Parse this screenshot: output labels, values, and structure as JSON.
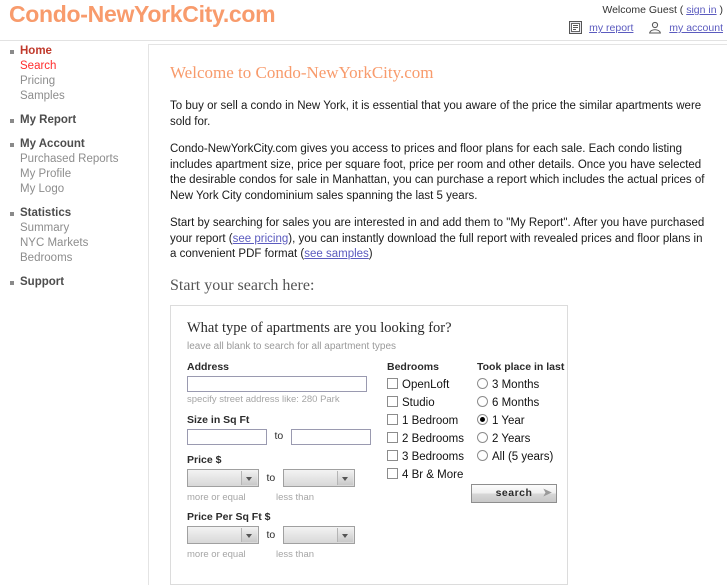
{
  "header": {
    "logo": "Condo-NewYorkCity.com",
    "welcome_prefix": "Welcome Guest (",
    "sign_in": "sign in",
    "welcome_suffix": ")",
    "my_report": "my report",
    "my_account": "my account",
    "report_icon": "report-icon",
    "account_icon": "account-person-icon",
    "logo_color": "#f89b6c",
    "link_color": "#5b5bbf"
  },
  "sidebar": {
    "groups": [
      {
        "head": "Home",
        "head_state": "home",
        "items": [
          {
            "label": "Search",
            "active": true
          },
          {
            "label": "Pricing",
            "active": false
          },
          {
            "label": "Samples",
            "active": false
          }
        ]
      },
      {
        "head": "My Report",
        "head_state": "normal",
        "items": []
      },
      {
        "head": "My Account",
        "head_state": "normal",
        "items": [
          {
            "label": "Purchased Reports",
            "active": false
          },
          {
            "label": "My Profile",
            "active": false
          },
          {
            "label": "My Logo",
            "active": false
          }
        ]
      },
      {
        "head": "Statistics",
        "head_state": "normal",
        "items": [
          {
            "label": "Summary",
            "active": false
          },
          {
            "label": "NYC Markets",
            "active": false
          },
          {
            "label": "Bedrooms",
            "active": false
          }
        ]
      },
      {
        "head": "Support",
        "head_state": "normal",
        "items": []
      }
    ]
  },
  "main": {
    "title": "Welcome to Condo-NewYorkCity.com",
    "para1": "To buy or sell a condo in New York, it is essential that you aware of the price the similar apartments were sold for.",
    "para2": "Condo-NewYorkCity.com gives you access to prices and floor plans for each sale. Each condo listing includes apartment size, price per square foot, price per room and other details. Once you have selected the desirable condos for sale in Manhattan, you can purchase a report which includes the actual prices of New York City condominium sales spanning the last 5 years.",
    "para3_a": "Start by searching for sales you are interested in and add them to \"My Report\". After you have purchased your report (",
    "para3_link1": "see pricing",
    "para3_b": "), you can instantly download the full report with revealed prices and floor plans in a convenient PDF format (",
    "para3_link2": "see samples",
    "para3_c": ")",
    "sub_title": "Start your search here:"
  },
  "form": {
    "question": "What type of apartments are you looking for?",
    "hint": "leave all blank to search for all apartment types",
    "address_label": "Address",
    "address_value": "",
    "address_placeholder": "",
    "address_note": "specify street address like: 280 Park",
    "size_label": "Size in Sq Ft",
    "size_min": "",
    "size_max": "",
    "to_word": "to",
    "price_label": "Price $",
    "price_min": "",
    "price_max": "",
    "price_per_sqft_label": "Price Per Sq Ft $",
    "price_per_sqft_min": "",
    "price_per_sqft_max": "",
    "more_or_equal": "more or equal",
    "less_than": "less than",
    "bedrooms_label": "Bedrooms",
    "bedrooms": [
      {
        "label": "OpenLoft",
        "checked": false
      },
      {
        "label": "Studio",
        "checked": false
      },
      {
        "label": "1 Bedroom",
        "checked": false
      },
      {
        "label": "2 Bedrooms",
        "checked": false
      },
      {
        "label": "3 Bedrooms",
        "checked": false
      },
      {
        "label": "4 Br & More",
        "checked": false
      }
    ],
    "took_place_label": "Took place in last",
    "took_place": [
      {
        "label": "3 Months",
        "selected": false
      },
      {
        "label": "6 Months",
        "selected": false
      },
      {
        "label": "1 Year",
        "selected": true
      },
      {
        "label": "2 Years",
        "selected": false
      },
      {
        "label": "All (5 years)",
        "selected": false
      }
    ],
    "search_button": "search"
  }
}
